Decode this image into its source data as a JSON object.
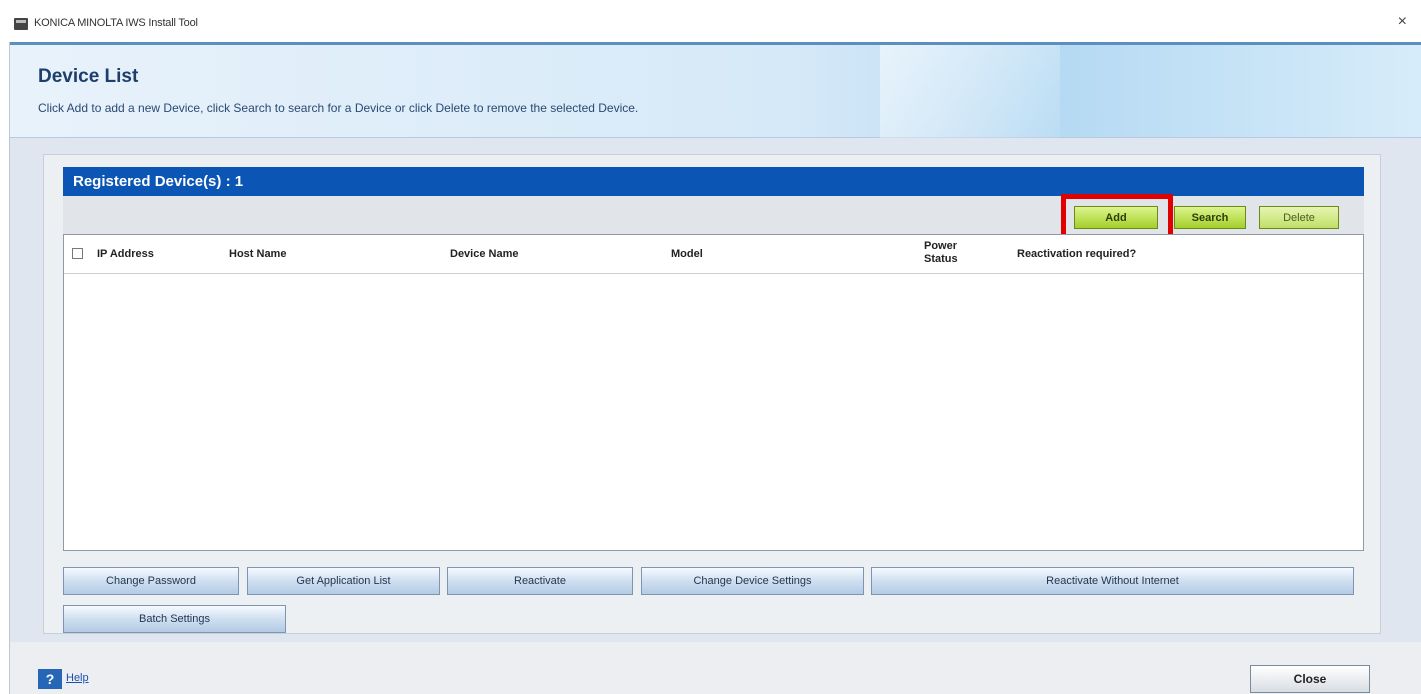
{
  "window": {
    "title": "KONICA MINOLTA IWS Install Tool",
    "close_glyph": "×"
  },
  "header": {
    "title": "Device List",
    "description": "Click Add to add a new Device, click Search to search for a Device or click Delete to remove the selected Device."
  },
  "registered": {
    "label": "Registered Device(s) : 1"
  },
  "toolbar": {
    "add_label": "Add",
    "search_label": "Search",
    "delete_label": "Delete"
  },
  "table": {
    "columns": {
      "ip": "IP Address",
      "host": "Host Name",
      "device": "Device Name",
      "model": "Model",
      "power": "Power Status",
      "reactivation": "Reactivation required?"
    },
    "rows": []
  },
  "actions": {
    "change_password": "Change Password",
    "get_app_list": "Get Application List",
    "reactivate": "Reactivate",
    "change_device_settings": "Change Device Settings",
    "reactivate_without_internet": "Reactivate Without Internet",
    "batch_settings": "Batch Settings"
  },
  "footer": {
    "help_label": "Help",
    "close_label": "Close"
  },
  "colors": {
    "header_bar": "#0b56b5",
    "highlight": "#e00000",
    "add_button": "#a3cf2a"
  },
  "icons": {
    "app": "printer-icon",
    "help": "question-icon"
  }
}
